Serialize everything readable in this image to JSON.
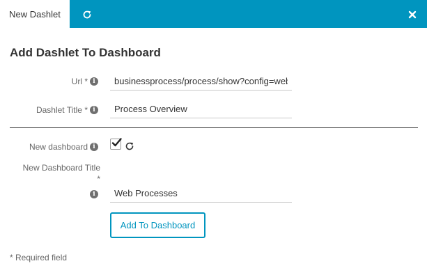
{
  "tabs": {
    "active_label": "New Dashlet",
    "refresh_icon": "refresh-icon",
    "close_icon": "close-icon"
  },
  "form": {
    "title": "Add Dashlet To Dashboard",
    "url": {
      "label": "Url *",
      "value": "businessprocess/process/show?config=web"
    },
    "dashlet_title": {
      "label": "Dashlet Title *",
      "value": "Process Overview"
    },
    "new_dashboard": {
      "label": "New dashboard",
      "checked": true
    },
    "new_dashboard_title": {
      "label_line1": "New Dashboard Title",
      "label_line2": "*",
      "value": "Web Processes"
    },
    "submit_label": "Add To Dashboard",
    "required_note": "* Required field"
  },
  "colors": {
    "accent": "#0095bf",
    "tab_bar": "#0095bf"
  }
}
